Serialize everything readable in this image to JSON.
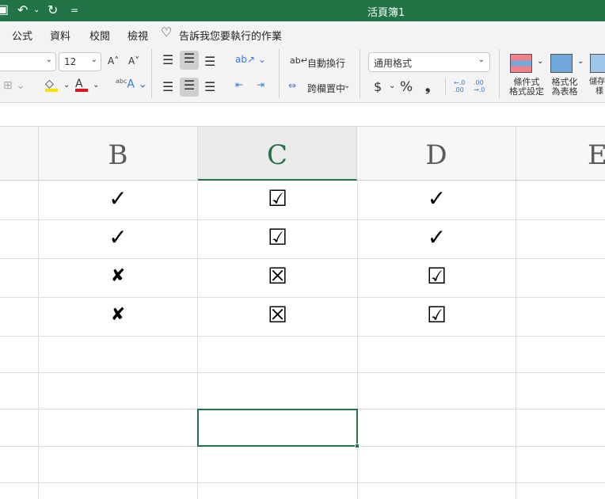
{
  "window": {
    "title": "活頁簿1"
  },
  "quick_access": {
    "save": "save-icon",
    "undo": "↶",
    "redo": "↻",
    "customize": "="
  },
  "ribbon_tabs": [
    "公式",
    "資料",
    "校閱",
    "檢視"
  ],
  "tell_me": "告訴我您要執行的作業",
  "font": {
    "size": "12",
    "grow": "A˄",
    "shrink": "A˅",
    "fill_color": "#f5e100",
    "font_color": "#e0141e"
  },
  "alignment": {
    "wrap_text": "自動換行",
    "merge_center": "跨欄置中"
  },
  "number": {
    "format": "通用格式",
    "currency": "$",
    "percent": "%",
    "comma": "❟",
    "inc_decimal": "←.0 .00",
    "dec_decimal": ".00 →.0"
  },
  "styles": {
    "conditional_formatting": [
      "條件式",
      "格式設定"
    ],
    "format_as_table": [
      "格式化",
      "為表格"
    ],
    "cell_styles": [
      "儲存",
      "樣"
    ]
  },
  "columns": [
    "B",
    "C",
    "D",
    "E"
  ],
  "active_column": "C",
  "rows": [
    [
      "✓",
      "☑",
      "✓"
    ],
    [
      "✓",
      "☑",
      "✓"
    ],
    [
      "✘",
      "☒",
      "☑"
    ],
    [
      "✘",
      "☒",
      "☑"
    ]
  ]
}
